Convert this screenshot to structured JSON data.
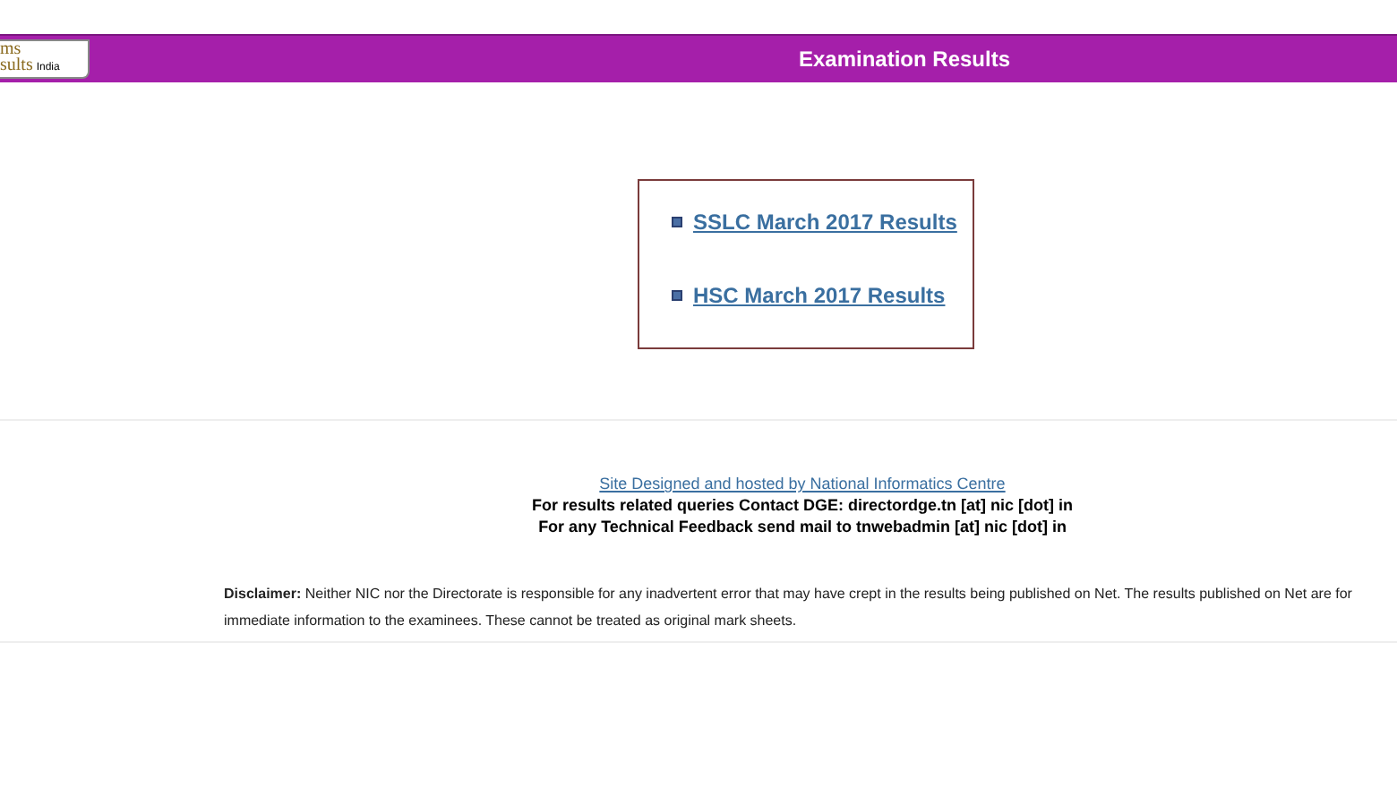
{
  "logo": {
    "line_1": "ms",
    "line_2": "sults",
    "tag": "India"
  },
  "header": {
    "title": "Examination Results"
  },
  "results_links": [
    "SSLC March 2017 Results",
    "HSC March 2017 Results"
  ],
  "footer": {
    "credit_link": "Site Designed and hosted by National Informatics Centre",
    "contact_lines": [
      "For results related queries Contact DGE:  directordge.tn [at] nic [dot] in",
      "For any Technical Feedback send mail to tnwebadmin [at] nic [dot] in"
    ]
  },
  "disclaimer": "**Disclaimer:** Neither NIC nor the Directorate is responsible for any inadvertent error that may have crept in the results being published on Net. The results published on Net are for immediate information to the examinees. These cannot be treated as original mark sheets."
}
